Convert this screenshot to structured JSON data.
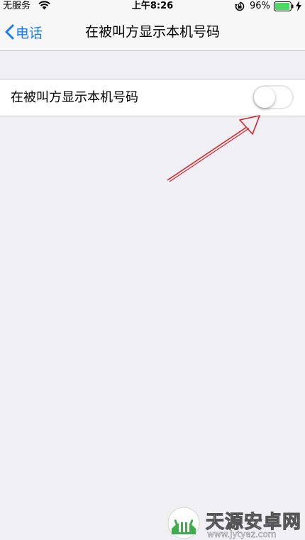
{
  "status_bar": {
    "carrier": "无服务",
    "time": "上午8:26",
    "battery_percent": "96%",
    "battery_level": 0.96,
    "battery_color": "#4cd964"
  },
  "nav": {
    "back_label": "电话",
    "title": "在被叫方显示本机号码",
    "accent_color": "#1b7bf7"
  },
  "settings": {
    "rows": [
      {
        "label": "在被叫方显示本机号码",
        "toggle_on": false
      }
    ]
  },
  "annotation": {
    "color": "#d8232a",
    "icon": "red-arrow-icon"
  },
  "watermark": {
    "title": "天源安卓网",
    "url": "www.jytyaz.com"
  }
}
